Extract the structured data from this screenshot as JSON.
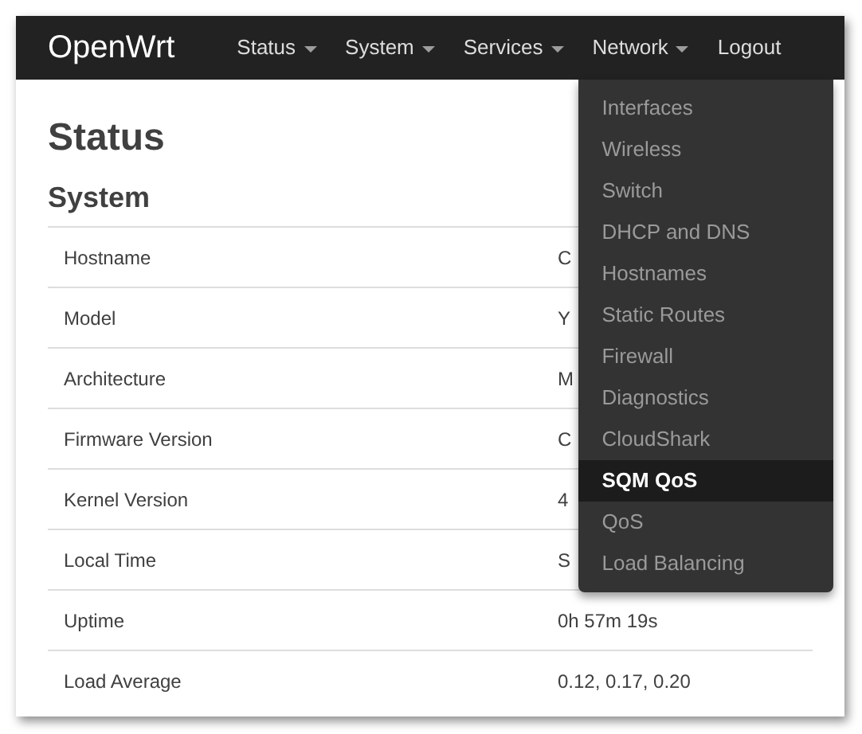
{
  "navbar": {
    "brand": "OpenWrt",
    "items": [
      {
        "label": "Status",
        "kind": "dropdown"
      },
      {
        "label": "System",
        "kind": "dropdown"
      },
      {
        "label": "Services",
        "kind": "dropdown"
      },
      {
        "label": "Network",
        "kind": "dropdown",
        "menu": [
          {
            "label": "Interfaces",
            "selected": false
          },
          {
            "label": "Wireless",
            "selected": false
          },
          {
            "label": "Switch",
            "selected": false
          },
          {
            "label": "DHCP and DNS",
            "selected": false
          },
          {
            "label": "Hostnames",
            "selected": false
          },
          {
            "label": "Static Routes",
            "selected": false
          },
          {
            "label": "Firewall",
            "selected": false
          },
          {
            "label": "Diagnostics",
            "selected": false
          },
          {
            "label": "CloudShark",
            "selected": false
          },
          {
            "label": "SQM QoS",
            "selected": true
          },
          {
            "label": "QoS",
            "selected": false
          },
          {
            "label": "Load Balancing",
            "selected": false
          }
        ]
      },
      {
        "label": "Logout",
        "kind": "link"
      }
    ]
  },
  "page_title": "Status",
  "section_title": "System",
  "table": {
    "rows": [
      {
        "label": "Hostname",
        "value": "C"
      },
      {
        "label": "Model",
        "value": "Y"
      },
      {
        "label": "Architecture",
        "value": "M"
      },
      {
        "label": "Firmware Version",
        "value": "C"
      },
      {
        "label": "Kernel Version",
        "value": "4"
      },
      {
        "label": "Local Time",
        "value": "S"
      },
      {
        "label": "Uptime",
        "value": "0h 57m 19s"
      },
      {
        "label": "Load Average",
        "value": "0.12, 0.17, 0.20"
      }
    ]
  }
}
